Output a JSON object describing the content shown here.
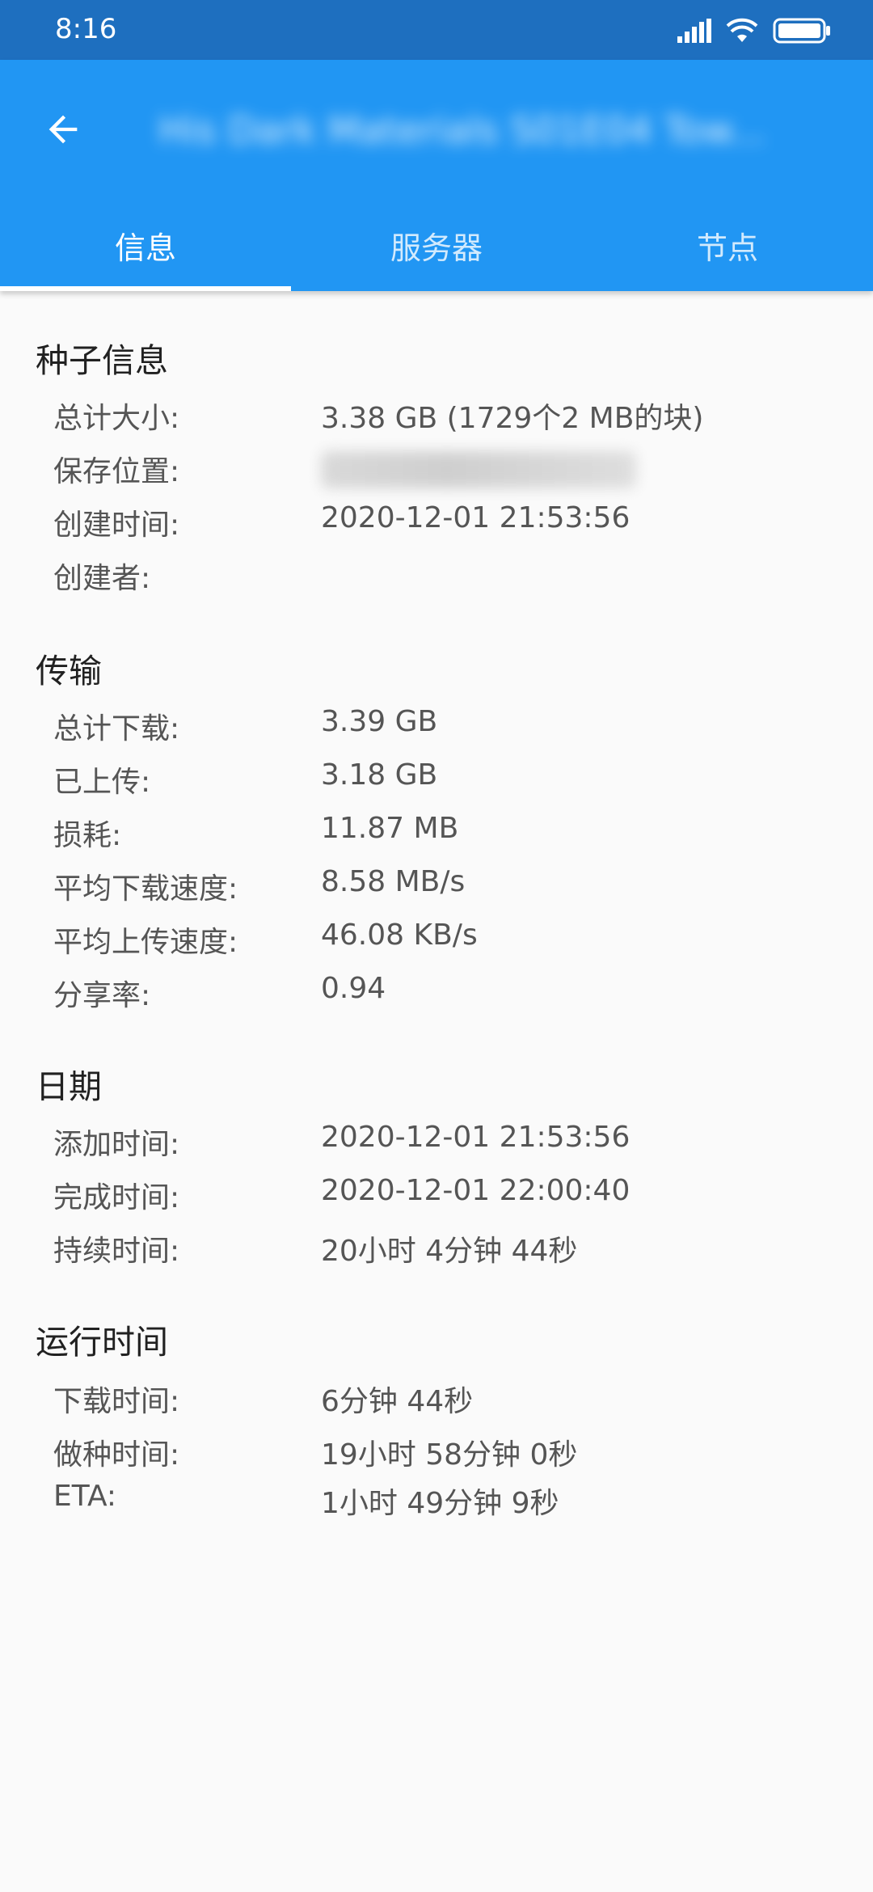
{
  "status_bar": {
    "time": "8:16"
  },
  "app_bar": {
    "title": "His Dark Materials S01E04 Tow...",
    "tabs": [
      {
        "label": "信息"
      },
      {
        "label": "服务器"
      },
      {
        "label": "节点"
      }
    ],
    "active_tab": "信息"
  },
  "sections": {
    "torrent_info": {
      "title": "种子信息",
      "total_size": {
        "label": "总计大小:",
        "value": "3.38 GB (1729个2 MB的块)"
      },
      "save_path": {
        "label": "保存位置:",
        "value": "/share/Video/2-电视剧/"
      },
      "created_time": {
        "label": "创建时间:",
        "value": "2020-12-01  21:53:56"
      },
      "creator": {
        "label": "创建者:",
        "value": ""
      }
    },
    "transfer": {
      "title": "传输",
      "total_download": {
        "label": "总计下载:",
        "value": "3.39 GB"
      },
      "uploaded": {
        "label": "已上传:",
        "value": "3.18 GB"
      },
      "wasted": {
        "label": "损耗:",
        "value": "11.87 MB"
      },
      "avg_download_speed": {
        "label": "平均下载速度:",
        "value": "8.58 MB/s"
      },
      "avg_upload_speed": {
        "label": "平均上传速度:",
        "value": "46.08 KB/s"
      },
      "share_ratio": {
        "label": "分享率:",
        "value": "0.94"
      }
    },
    "dates": {
      "title": "日期",
      "added_time": {
        "label": "添加时间:",
        "value": "2020-12-01  21:53:56"
      },
      "completed_time": {
        "label": "完成时间:",
        "value": "2020-12-01  22:00:40"
      },
      "duration": {
        "label": "持续时间:",
        "value": "20小时 4分钟 44秒"
      }
    },
    "runtime": {
      "title": "运行时间",
      "download_time": {
        "label": "下载时间:",
        "value": "6分钟 44秒"
      },
      "seed_time": {
        "label": "做种时间:",
        "value": "19小时 58分钟 0秒"
      },
      "eta": {
        "label": "ETA:",
        "value": "1小时 49分钟 9秒"
      }
    }
  },
  "colors": {
    "status_bar": "#1e6fbf",
    "app_bar": "#2196f3",
    "background": "#fafafa"
  }
}
